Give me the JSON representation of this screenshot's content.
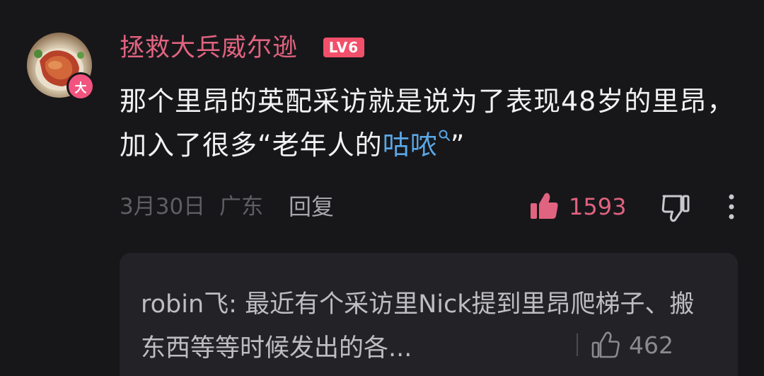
{
  "comment": {
    "avatar_badge": "大",
    "username": "拯救大兵威尔逊",
    "level": "LV6",
    "text_before": "那个里昂的英配采访就是说为了表现48岁的里昂，加入了很多“老年人的",
    "keyword": "咕哝",
    "text_after": "”",
    "date": "3月30日",
    "location": "广东",
    "reply_label": "回复",
    "like_count": "1593"
  },
  "reply": {
    "text": "robin飞: 最近有个采访里Nick提到里昂爬梯子、搬东西等等时候发出的各...",
    "like_count": "462"
  },
  "colors": {
    "background": "#17171a",
    "username": "#e0637f",
    "like": "#e0637f",
    "keyword": "#5aa7e6",
    "reply_box": "#232327"
  }
}
